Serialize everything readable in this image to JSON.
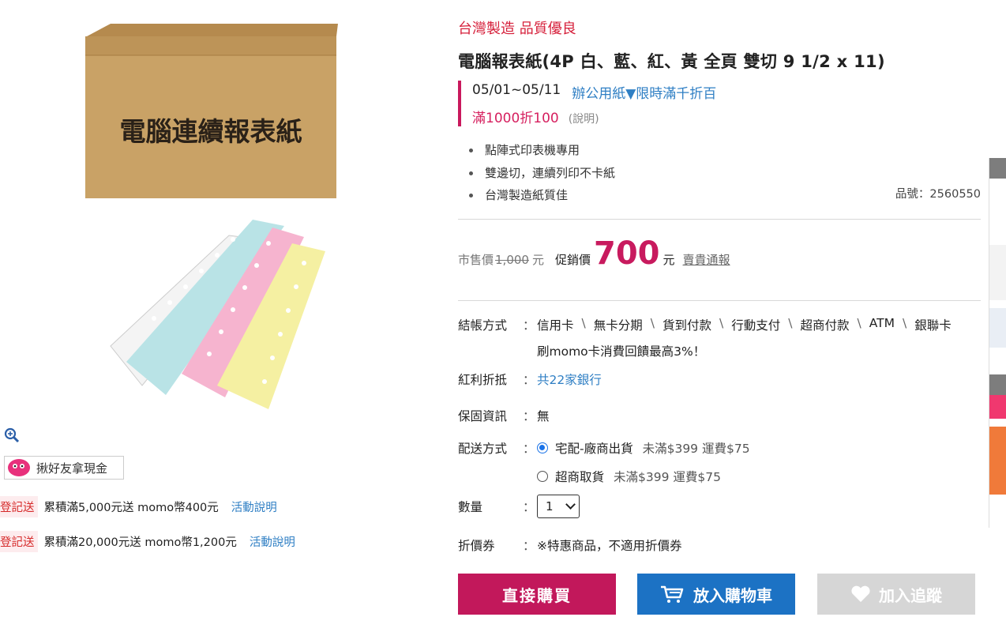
{
  "gallery": {
    "box_label": "電腦連續報表紙",
    "invite_button": "揪好友拿現金",
    "promotions": [
      {
        "tag": "登記送",
        "text": "累積滿5,000元送 momo幣400元",
        "link": "活動說明"
      },
      {
        "tag": "登記送",
        "text": "累積滿20,000元送 momo幣1,200元",
        "link": "活動說明"
      }
    ]
  },
  "product": {
    "slogan": "台灣製造 品質優良",
    "title": "電腦報表紙(4P 白、藍、紅、黃 全頁 雙切 9 1/2 x 11)",
    "event": {
      "date": "05/01~05/11",
      "link": "辦公用紙▼限時滿千折百",
      "offer": "滿1000折100",
      "explain": "(說明)"
    },
    "features": [
      "點陣式印表機專用",
      "雙邊切，連續列印不卡紙",
      "台灣製造紙質佳"
    ],
    "sku": "品號：2560550"
  },
  "price": {
    "market_label": "市售價",
    "market_price": "1,000",
    "market_unit": "元",
    "promo_label": "促銷價",
    "promo_price": "700",
    "promo_unit": "元",
    "report_link": "賣貴通報"
  },
  "details": {
    "payment_label": "結帳方式",
    "payment_methods": [
      "信用卡",
      "無卡分期",
      "貨到付款",
      "行動支付",
      "超商付款",
      "ATM",
      "銀聯卡"
    ],
    "payment_sep": "\\",
    "momo_note": "刷momo卡消費回饋最高3%！",
    "bonus_label": "紅利折抵",
    "bonus_value": "共22家銀行",
    "warranty_label": "保固資訊",
    "warranty_value": "無",
    "shipping_label": "配送方式",
    "shipping_options": [
      {
        "name": "宅配-廠商出貨",
        "fee": "未滿$399 運費$75",
        "selected": true
      },
      {
        "name": "超商取貨",
        "fee": "未滿$399 運費$75",
        "selected": false
      }
    ],
    "quantity_label": "數量",
    "quantity_value": "1",
    "coupon_label": "折價券",
    "coupon_value": "※特惠商品，不適用折價券",
    "colon": "："
  },
  "actions": {
    "buy_now": "直接購買",
    "add_cart": "放入購物車",
    "add_track": "加入追蹤"
  },
  "colors": {
    "brand_pink": "#c2185b",
    "cart_blue": "#1c72c4",
    "link_blue": "#2f7fc4",
    "slogan_red": "#d6203b"
  }
}
